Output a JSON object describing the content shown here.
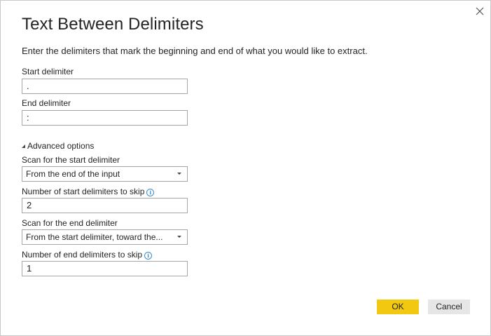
{
  "dialog": {
    "title": "Text Between Delimiters",
    "description": "Enter the delimiters that mark the beginning and end of what you would like to extract.",
    "close_icon": "close-icon"
  },
  "start_delimiter": {
    "label": "Start delimiter",
    "value": "."
  },
  "end_delimiter": {
    "label": "End delimiter",
    "value": ":"
  },
  "advanced": {
    "toggle_label": "Advanced options",
    "scan_start": {
      "label": "Scan for the start delimiter",
      "selected": "From the end of the input"
    },
    "skip_start": {
      "label": "Number of start delimiters to skip",
      "value": "2"
    },
    "scan_end": {
      "label": "Scan for the end delimiter",
      "selected": "From the start delimiter, toward the..."
    },
    "skip_end": {
      "label": "Number of end delimiters to skip",
      "value": "1"
    }
  },
  "buttons": {
    "ok": "OK",
    "cancel": "Cancel"
  },
  "colors": {
    "accent": "#f2c811",
    "info": "#3b8cc9",
    "border": "#a6a6a6"
  }
}
